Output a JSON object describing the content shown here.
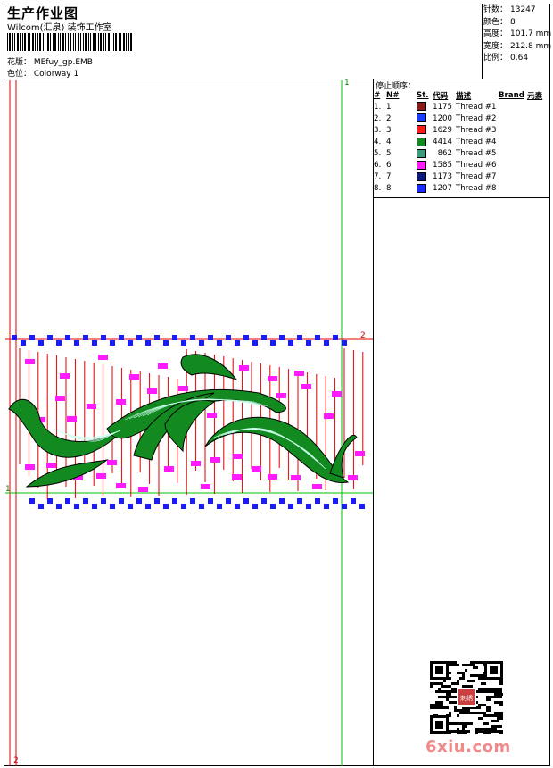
{
  "header": {
    "title": "生产作业图",
    "subtitle": "Wilcom(汇泉) 装饰工作室",
    "design_label": "花版：",
    "design_value": "MEfuy_gp.EMB",
    "colorway_label": "色位：",
    "colorway_value": "Colorway 1"
  },
  "specs": [
    {
      "label": "针数：",
      "value": "13247"
    },
    {
      "label": "颜色：",
      "value": "8"
    },
    {
      "label": "高度：",
      "value": "101.7 mm"
    },
    {
      "label": "宽度：",
      "value": "212.8 mm"
    },
    {
      "label": "比例：",
      "value": "0.64"
    }
  ],
  "stop_sequence": {
    "title": "停止顺序：",
    "columns": [
      "#",
      "N#",
      "St.",
      "代码",
      "描述",
      "Brand",
      "元素"
    ],
    "rows": [
      {
        "num": "1.",
        "n": "1",
        "color": "#8b1a1a",
        "code": "1175",
        "desc": "Thread #1"
      },
      {
        "num": "2.",
        "n": "2",
        "color": "#1a3cff",
        "code": "1200",
        "desc": "Thread #2"
      },
      {
        "num": "3.",
        "n": "3",
        "color": "#ff1a1a",
        "code": "1629",
        "desc": "Thread #3"
      },
      {
        "num": "4.",
        "n": "4",
        "color": "#138a1f",
        "code": "4414",
        "desc": "Thread #4"
      },
      {
        "num": "5.",
        "n": "5",
        "color": "#3d9a7a",
        "code": "862",
        "desc": "Thread #5"
      },
      {
        "num": "6.",
        "n": "6",
        "color": "#ff1aff",
        "code": "1585",
        "desc": "Thread #6"
      },
      {
        "num": "7.",
        "n": "7",
        "color": "#0a1a7a",
        "code": "1173",
        "desc": "Thread #7"
      },
      {
        "num": "8.",
        "n": "8",
        "color": "#1a2aff",
        "code": "1207",
        "desc": "Thread #8"
      }
    ]
  },
  "markers": {
    "green_top": "1",
    "red_right": "2",
    "green_left": "1",
    "red_bottom": "2"
  },
  "watermark": {
    "logo": "6xiu.com",
    "seal_text": "刺绣"
  },
  "colors": {
    "frame": "#000000",
    "red_line": "#e00000",
    "green_line": "#00c000",
    "blue_block": "#1a1aff",
    "magenta": "#ff1aff",
    "leaf": "#138a1f"
  }
}
